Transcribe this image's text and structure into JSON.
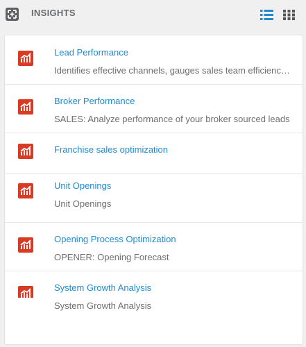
{
  "header": {
    "title": "INSIGHTS",
    "icons": {
      "expand": "expand-icon",
      "list_view": "list-view-icon",
      "grid_view": "grid-view-icon"
    }
  },
  "colors": {
    "accent": "#1f8ad0",
    "report_icon": "#d93a24",
    "header_text": "#6a6c70",
    "description_text": "#6e6e6e"
  },
  "insights": [
    {
      "name": "Lead Performance",
      "description": "Identifies effective channels, gauges sales team efficiency and more",
      "icon": "bar-chart-icon"
    },
    {
      "name": "Broker Performance",
      "description": "SALES: Analyze performance of your broker sourced leads",
      "icon": "bar-chart-icon"
    },
    {
      "name": "Franchise sales optimization",
      "description": "",
      "icon": "bar-chart-icon"
    },
    {
      "name": "Unit Openings",
      "description": "Unit Openings",
      "icon": "bar-chart-icon"
    },
    {
      "name": "Opening Process Optimization",
      "description": "OPENER: Opening Forecast",
      "icon": "bar-chart-icon"
    },
    {
      "name": "System Growth Analysis",
      "description": "System Growth Analysis",
      "icon": "bar-chart-icon"
    }
  ]
}
